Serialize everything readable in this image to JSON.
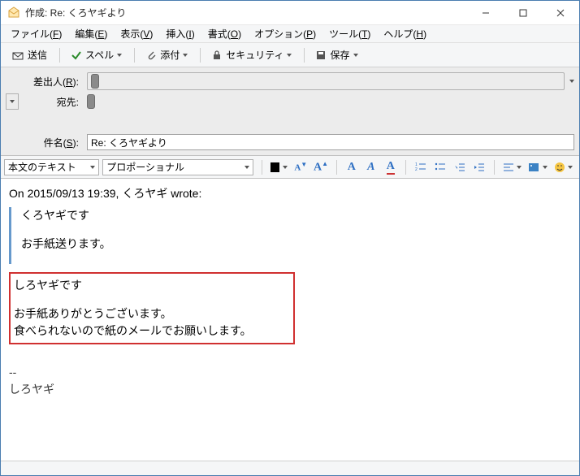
{
  "titlebar": {
    "title": "作成: Re: くろヤギより"
  },
  "menu": {
    "file": "ファイル(",
    "file_k": "F",
    "edit": "編集(",
    "edit_k": "E",
    "view": "表示(",
    "view_k": "V",
    "insert": "挿入(",
    "insert_k": "I",
    "format": "書式(",
    "format_k": "O",
    "options": "オプション(",
    "options_k": "P",
    "tools": "ツール(",
    "tools_k": "T",
    "help": "ヘルプ(",
    "help_k": "H",
    "close": ")"
  },
  "toolbar": {
    "send": "送信",
    "spell": "スペル",
    "attach": "添付",
    "security": "セキュリティ",
    "save": "保存"
  },
  "headers": {
    "from_label": "差出人(",
    "from_k": "R",
    "to_label": "宛先:",
    "subject_label": "件名(",
    "subject_k": "S",
    "subject_value": "Re: くろヤギより"
  },
  "format": {
    "style_selected": "本文のテキスト",
    "font_selected": "プロポーショナル"
  },
  "body": {
    "attribution": "On 2015/09/13 19:39, くろヤギ wrote:",
    "quote1": "くろヤギです",
    "quote2": "お手紙送ります。",
    "reply1": "しろヤギです",
    "reply2": "お手紙ありがとうございます。",
    "reply3": "食べられないので紙のメールでお願いします。",
    "sigsep": "--",
    "sig": "しろヤギ"
  }
}
